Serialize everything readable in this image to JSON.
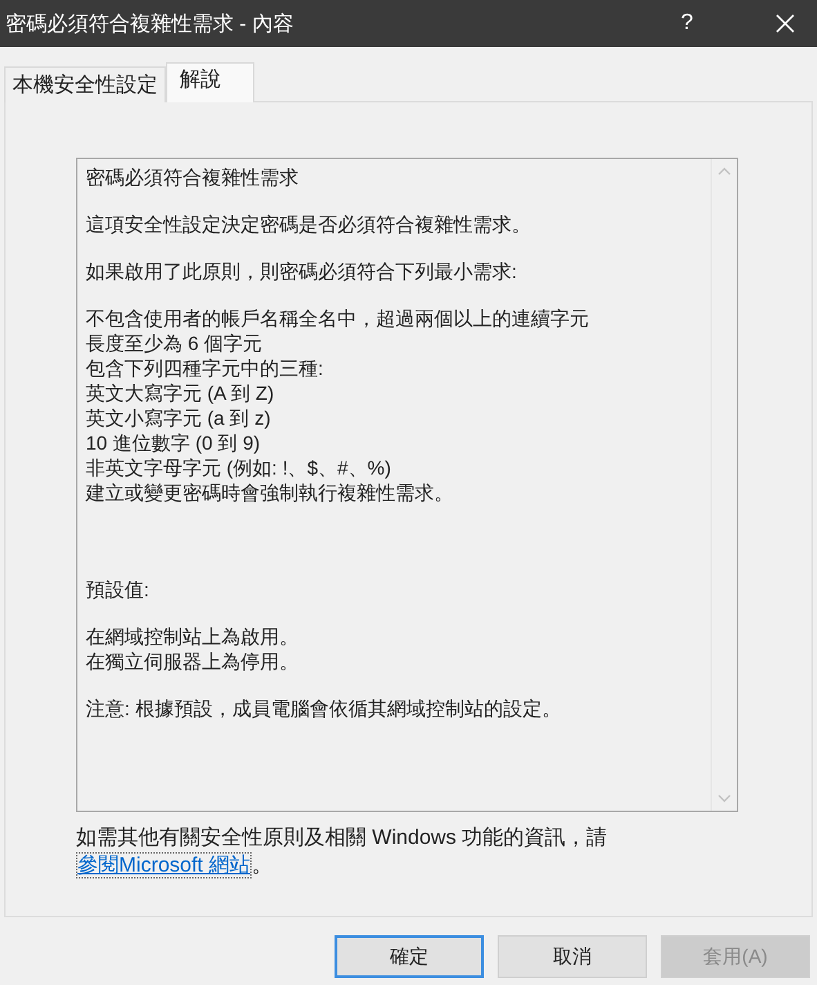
{
  "window": {
    "title": "密碼必須符合複雜性需求 - 內容",
    "help": "?"
  },
  "tabs": [
    {
      "label": "本機安全性設定",
      "selected": false
    },
    {
      "label": "解說",
      "selected": true
    }
  ],
  "explanation": {
    "sections": [
      {
        "paragraphs": [
          [
            "密碼必須符合複雜性需求"
          ],
          [
            "這項安全性設定決定密碼是否必須符合複雜性需求。"
          ],
          [
            "如果啟用了此原則，則密碼必須符合下列最小需求:"
          ],
          [
            "不包含使用者的帳戶名稱全名中，超過兩個以上的連續字元",
            "長度至少為 6 個字元",
            "包含下列四種字元中的三種:",
            "英文大寫字元 (A 到 Z)",
            "英文小寫字元 (a 到 z)",
            "10 進位數字 (0 到 9)",
            "非英文字母字元 (例如: !、$、#、%)",
            "建立或變更密碼時會強制執行複雜性需求。"
          ]
        ]
      },
      {
        "paragraphs": [
          [
            "預設值:"
          ],
          [
            "在網域控制站上為啟用。",
            "在獨立伺服器上為停用。"
          ],
          [
            "注意: 根據預設，成員電腦會依循其網域控制站的設定。"
          ]
        ]
      }
    ]
  },
  "more_info": {
    "text": "如需其他有關安全性原則及相關 Windows 功能的資訊，請",
    "link": "參閱Microsoft 網站",
    "end": "。"
  },
  "buttons": [
    {
      "label": "確定",
      "kind": "default",
      "disabled": false
    },
    {
      "label": "取消",
      "kind": "normal",
      "disabled": false
    },
    {
      "label": "套用(A)",
      "kind": "normal",
      "disabled": true
    }
  ]
}
